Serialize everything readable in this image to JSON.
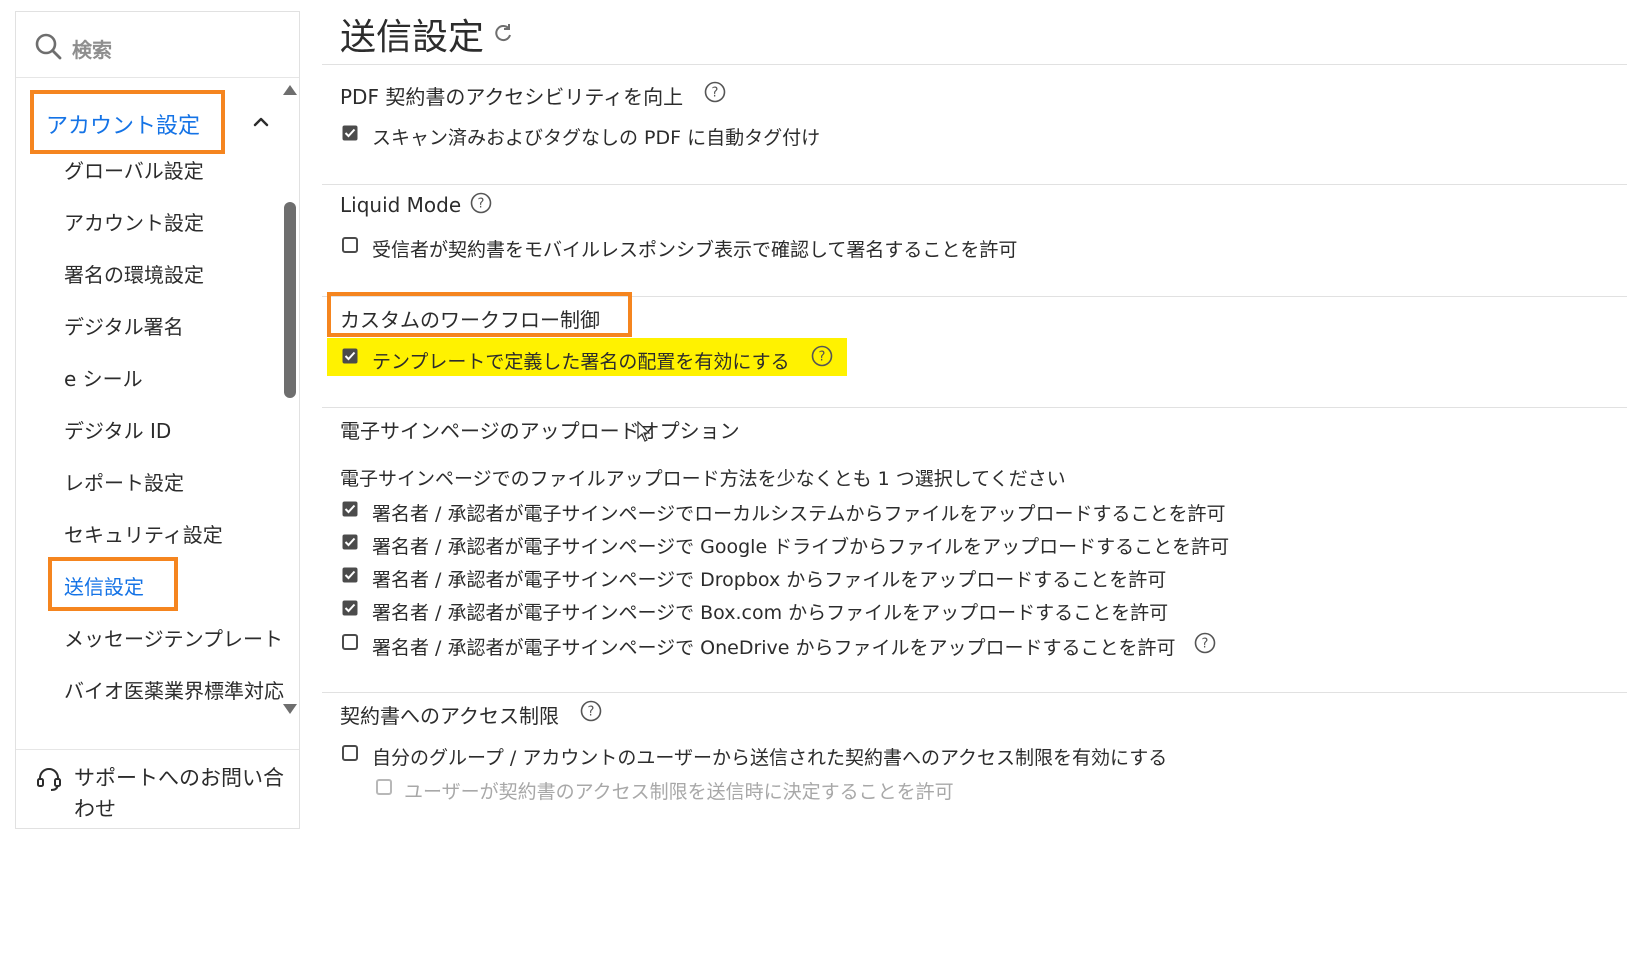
{
  "sidebar": {
    "search_placeholder": "検索",
    "group": {
      "label": "アカウント設定",
      "expanded": true
    },
    "items": [
      {
        "label": "グローバル設定"
      },
      {
        "label": "アカウント設定"
      },
      {
        "label": "署名の環境設定"
      },
      {
        "label": "デジタル署名"
      },
      {
        "label": "e シール"
      },
      {
        "label": "デジタル ID"
      },
      {
        "label": "レポート設定"
      },
      {
        "label": "セキュリティ設定"
      },
      {
        "label": "送信設定",
        "active": true
      },
      {
        "label": "メッセージテンプレート"
      },
      {
        "label": "バイオ医薬業界標準対応"
      }
    ],
    "support_label": "サポートへのお問い合わせ"
  },
  "main": {
    "title": "送信設定",
    "sections": [
      {
        "title": "PDF 契約書のアクセシビリティを向上",
        "options": [
          {
            "label": "スキャン済みおよびタグなしの PDF に自動タグ付け",
            "checked": true
          }
        ]
      },
      {
        "title": "Liquid Mode",
        "options": [
          {
            "label": "受信者が契約書をモバイルレスポンシブ表示で確認して署名することを許可",
            "checked": false
          }
        ]
      },
      {
        "title": "カスタムのワークフロー制御",
        "options": [
          {
            "label": "テンプレートで定義した署名の配置を有効にする",
            "checked": true
          }
        ]
      },
      {
        "title": "電子サインページのアップロードオプション",
        "description": "電子サインページでのファイルアップロード方法を少なくとも 1 つ選択してください",
        "options": [
          {
            "label": "署名者 / 承認者が電子サインページでローカルシステムからファイルをアップロードすることを許可",
            "checked": true
          },
          {
            "label": "署名者 / 承認者が電子サインページで Google ドライブからファイルをアップロードすることを許可",
            "checked": true
          },
          {
            "label": "署名者 / 承認者が電子サインページで Dropbox からファイルをアップロードすることを許可",
            "checked": true
          },
          {
            "label": "署名者 / 承認者が電子サインページで Box.com からファイルをアップロードすることを許可",
            "checked": true
          },
          {
            "label": "署名者 / 承認者が電子サインページで OneDrive からファイルをアップロードすることを許可",
            "checked": false
          }
        ]
      },
      {
        "title": "契約書へのアクセス制限",
        "options": [
          {
            "label": "自分のグループ / アカウントのユーザーから送信された契約書へのアクセス制限を有効にする",
            "checked": false
          },
          {
            "label": "ユーザーが契約書のアクセス制限を送信時に決定することを許可",
            "checked": false,
            "disabled": true
          }
        ]
      }
    ]
  },
  "colors": {
    "accent_blue": "#1473e6",
    "annotation_orange": "#f5851f",
    "highlight_yellow": "#fff200"
  }
}
